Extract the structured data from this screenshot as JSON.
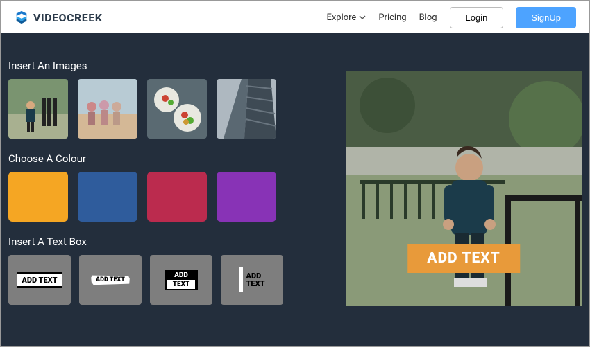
{
  "brand": "VIDEOCREEK",
  "nav": {
    "explore": "Explore",
    "pricing": "Pricing",
    "blog": "Blog",
    "login": "Login",
    "signup": "SignUp"
  },
  "sections": {
    "images": "Insert An Images",
    "colour": "Choose A Colour",
    "textbox": "Insert A Text Box"
  },
  "colours": [
    "#f5a623",
    "#2f5c9c",
    "#bb2b4e",
    "#8833b6"
  ],
  "addtext": "ADD TEXT",
  "addtext_split_top": "ADD",
  "addtext_split_bot": "TEXT",
  "banner": "ADD TEXT"
}
